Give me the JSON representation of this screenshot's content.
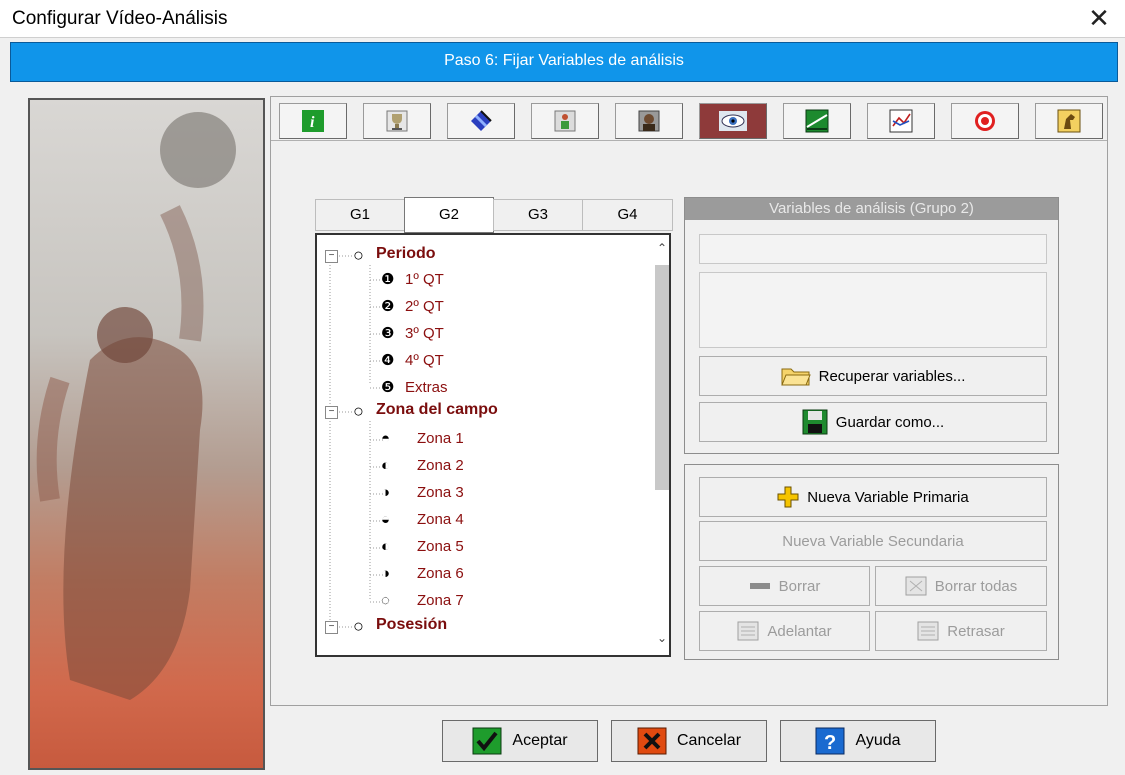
{
  "window": {
    "title": "Configurar Vídeo-Análisis",
    "close": "✕"
  },
  "banner": {
    "text": "Paso 6: Fijar Variables de análisis"
  },
  "toolbar": {
    "buttons": [
      "info-icon",
      "trophy-icon",
      "court-icon",
      "player-stats-icon",
      "player-portrait-icon",
      "eye-icon",
      "pitch-icon",
      "chart-icon",
      "target-icon",
      "horse-icon"
    ],
    "active_index": 5
  },
  "tabs": [
    "G1",
    "G2",
    "G3",
    "G4"
  ],
  "selected_tab": "G2",
  "tree": {
    "groups": [
      {
        "label": "Periodo",
        "items": [
          {
            "glyph": "❶",
            "label": "1º QT"
          },
          {
            "glyph": "❷",
            "label": "2º QT"
          },
          {
            "glyph": "❸",
            "label": "3º QT"
          },
          {
            "glyph": "❹",
            "label": "4º QT"
          },
          {
            "glyph": "❺",
            "label": "Extras"
          }
        ]
      },
      {
        "label": "Zona del campo",
        "items": [
          {
            "glyph": "◓",
            "label": "Zona 1"
          },
          {
            "glyph": "◐",
            "label": "Zona 2"
          },
          {
            "glyph": "◑",
            "label": "Zona 3"
          },
          {
            "glyph": "◒",
            "label": "Zona 4"
          },
          {
            "glyph": "◐",
            "label": "Zona 5"
          },
          {
            "glyph": "◑",
            "label": "Zona 6"
          },
          {
            "glyph": "◌",
            "label": "Zona 7"
          }
        ]
      },
      {
        "label": "Posesión",
        "items": []
      }
    ],
    "expander": "⊟"
  },
  "variables_panel": {
    "header": "Variables de análisis (Grupo 2)",
    "name_field": "",
    "description_field": "",
    "recover_label": "Recuperar variables...",
    "save_label": "Guardar como..."
  },
  "actions": {
    "new_primary": "Nueva Variable Primaria",
    "new_secondary": "Nueva Variable Secundaria",
    "delete": "Borrar",
    "delete_all": "Borrar todas",
    "forward": "Adelantar",
    "back": "Retrasar"
  },
  "footer": {
    "accept": "Aceptar",
    "cancel": "Cancelar",
    "help": "Ayuda"
  }
}
